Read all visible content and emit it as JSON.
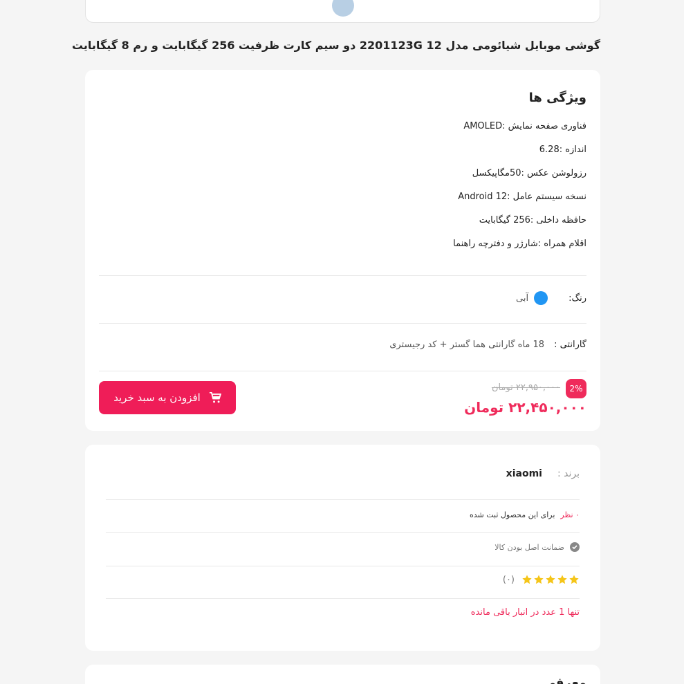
{
  "product": {
    "title": "گوشی موبایل شیائومی مدل 12 2201123G دو سیم کارت ظرفیت 256 گیگابایت و رم 8 گیگابایت"
  },
  "features": {
    "title": "ویژگی ها",
    "items": [
      "فناوری صفحه نمایش :AMOLED",
      "اندازه :6.28",
      "رزولوشن عکس :50مگاپیکسل",
      "نسخه سیستم عامل :Android 12",
      "حافظه داخلی :256 گیگابایت",
      "اقلام همراه :شارژر و دفترچه راهنما"
    ]
  },
  "color": {
    "label": "رنگ:",
    "name": "آبی",
    "hex": "#2196f3"
  },
  "warranty": {
    "label": "گارانتی :",
    "value": "18 ماه گارانتی هما گستر + کد رجیستری"
  },
  "price": {
    "discount": "2%",
    "old": "۲۲,۹۵۰,۰۰۰ تومان",
    "new": "۲۲,۴۵۰,۰۰۰ تومان"
  },
  "cart": {
    "label": "افزودن به سبد خرید",
    "icon": "cart-icon"
  },
  "info": {
    "brand_label": "برند :",
    "brand_value": "xiaomi",
    "comments_count": "۰ نظر",
    "comments_text": "برای این محصول ثبت شده",
    "guarantee": "ضمانت اصل بودن کالا",
    "rating_stars": 5,
    "rating_count": "(۰)",
    "stock": "تنها 1 عدد در انبار باقی مانده"
  },
  "next_section": {
    "title": "معرفی"
  },
  "colors": {
    "accent": "#ef2b5b",
    "star": "#f5c518"
  }
}
